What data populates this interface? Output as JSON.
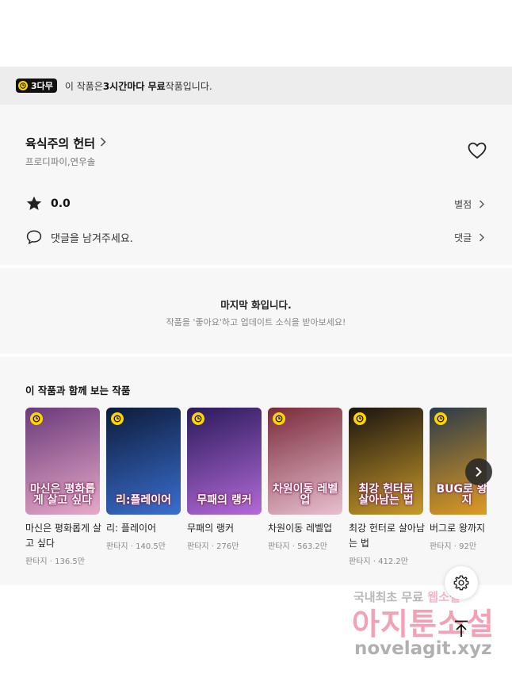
{
  "notice": {
    "badge": "3다무",
    "prefix": "이 작품은 ",
    "highlight": "3시간마다 무료",
    "suffix": " 작품입니다."
  },
  "work": {
    "title": "육식주의 헌터",
    "authors": "프로디파이,연우솔",
    "rating": "0.0",
    "rating_link": "별점",
    "comment_prompt": "댓글을 남겨주세요.",
    "comment_link": "댓글"
  },
  "last_episode": {
    "title": "마지막 화입니다.",
    "subtitle": "작품을 '좋아요'하고 업데이트 소식을 받아보세요!"
  },
  "recommendations": {
    "heading": "이 작품과 함께 보는 작품",
    "items": [
      {
        "title": "마신은 평화롭게 살고 싶다",
        "meta": "판타지 · 136.5만",
        "cover_text": "마신은 평화롭게 살고 싶다",
        "bg": "#6a3a7a",
        "bg2": "#e6a9c7"
      },
      {
        "title": "리: 플레이어",
        "meta": "판타지 · 140.5만",
        "cover_text": "리:플레이어",
        "bg": "#0d1b3a",
        "bg2": "#3a6fd0"
      },
      {
        "title": "무패의 랭커",
        "meta": "판타지 · 276만",
        "cover_text": "무패의 랭커",
        "bg": "#2a1a5a",
        "bg2": "#b36ad8"
      },
      {
        "title": "차원이동 레벨업",
        "meta": "판타지 · 563.2만",
        "cover_text": "차원이동 레벨업",
        "bg": "#7a2a3a",
        "bg2": "#e8c0d0"
      },
      {
        "title": "최강 헌터로 살아남는 법",
        "meta": "판타지 · 412.2만",
        "cover_text": "최강 헌터로 살아남는 법",
        "bg": "#1a1410",
        "bg2": "#c89a2a"
      },
      {
        "title": "버그로 왕까지",
        "meta": "판타지 · 92만",
        "cover_text": "BUG로 왕까지",
        "bg": "#2a3a4a",
        "bg2": "#e8a020"
      }
    ]
  },
  "watermark": {
    "line1_prefix": "국내최초 무료",
    "line1_highlight": "웹소설",
    "line2": "아지툰소설",
    "line3": "novelagit.xyz"
  },
  "colors": {
    "accent_yellow": "#ffd400",
    "notice_bg": "#ededed",
    "panel_bg": "#f7f7f7"
  },
  "icons": [
    "clock-icon",
    "chevron-right-icon",
    "heart-icon",
    "star-icon",
    "comment-icon",
    "gear-icon",
    "arrow-up-icon"
  ]
}
